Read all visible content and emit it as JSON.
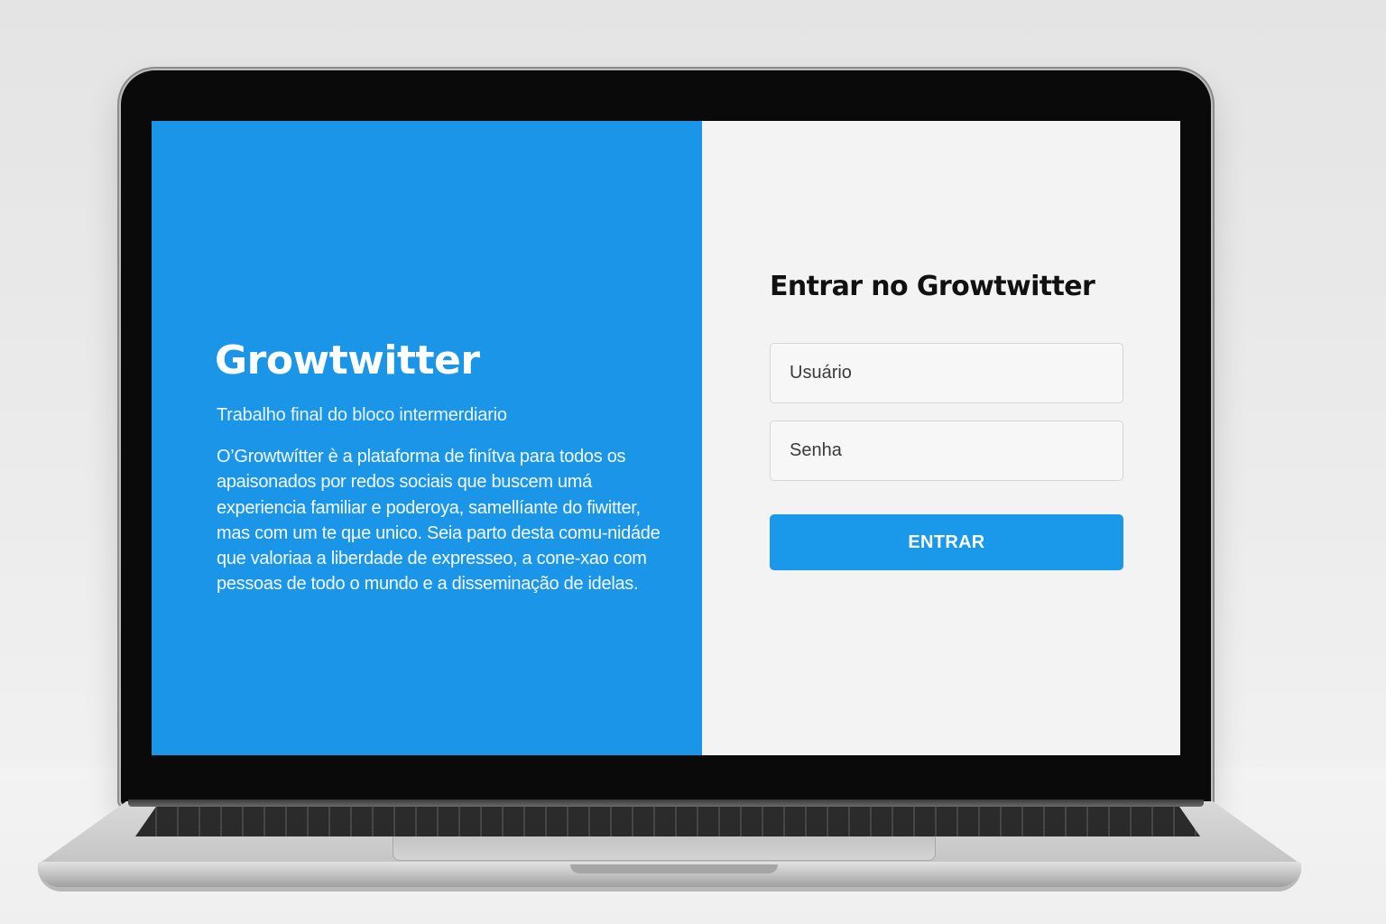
{
  "brand": {
    "title": "Growtwitter",
    "subtitle": "Trabalho final do bloco intermerdiario",
    "description": "O’Growtwítter è a plataforma de finítva para todos os apaisonados por redos sociais que buscem umá experiencia familiar e poderoya, samellíante do fiwitter, mas com um te qµe unico. Seia parto desta comu-nidáde que valoriaa a liberdade de expresseo, a cone-xao com pessoas de todo o mundo e a disseminação de idelas."
  },
  "login": {
    "title": "Entrar no Growtwitter",
    "username_placeholder": "Usuário",
    "username_value": "",
    "password_placeholder": "Senha",
    "password_value": "",
    "submit_label": "ENTRAR"
  },
  "colors": {
    "brand_panel": "#1b95e8",
    "login_panel": "#f3f3f3",
    "button": "#1a98ea"
  }
}
